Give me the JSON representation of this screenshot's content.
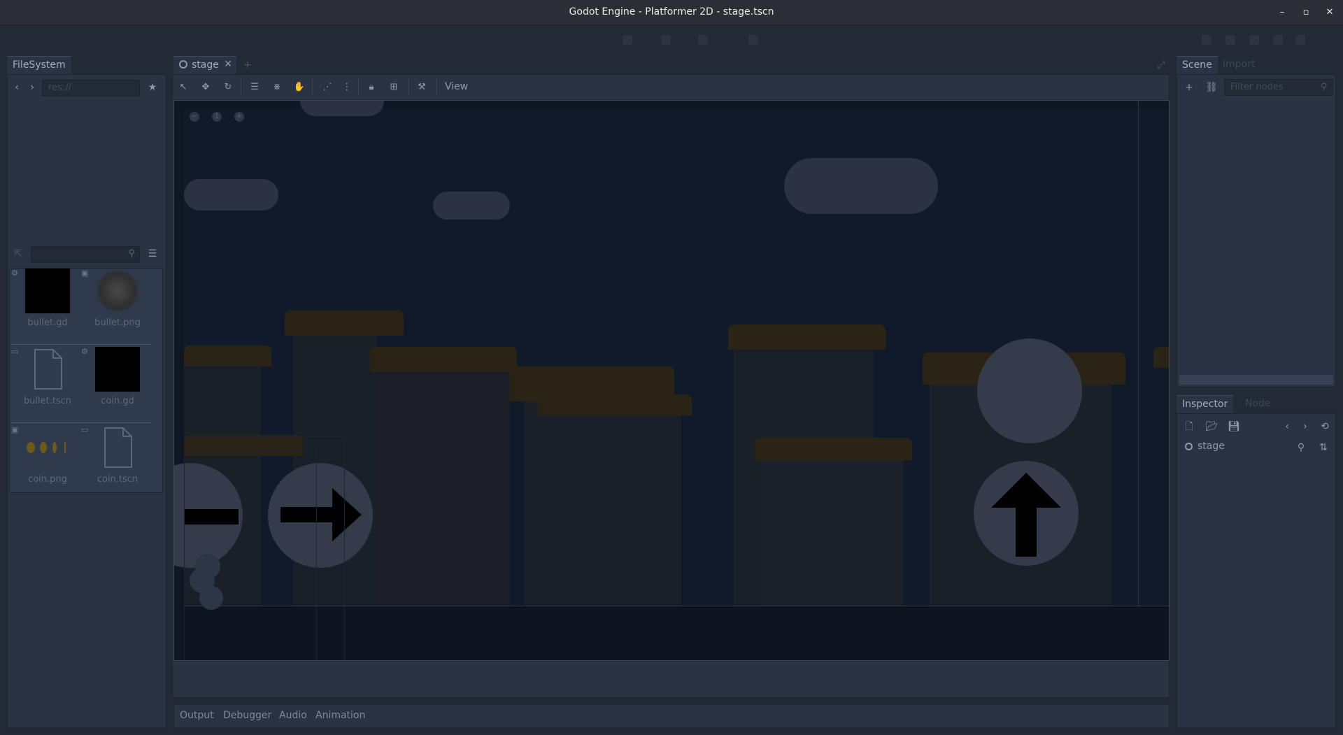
{
  "window": {
    "title": "Godot Engine - Platformer 2D - stage.tscn",
    "minimize": "–",
    "maximize": "▫",
    "close": "✕"
  },
  "filesystem": {
    "tab_label": "FileSystem",
    "path_value": "res://",
    "search_placeholder": "",
    "files": [
      {
        "name": "bullet.gd",
        "kind": "script"
      },
      {
        "name": "bullet.png",
        "kind": "image"
      },
      {
        "name": "bullet.tscn",
        "kind": "scene"
      },
      {
        "name": "coin.gd",
        "kind": "script"
      },
      {
        "name": "coin.png",
        "kind": "image"
      },
      {
        "name": "coin.tscn",
        "kind": "scene"
      }
    ]
  },
  "editor": {
    "scene_tab": "stage",
    "view_menu": "View"
  },
  "scene_dock": {
    "tabs": [
      "Scene",
      "Import"
    ],
    "filter_placeholder": "Filter nodes"
  },
  "inspector": {
    "tabs": [
      "Inspector",
      "Node"
    ],
    "node_name": "stage"
  },
  "bottom": {
    "tabs": [
      "Output",
      "Debugger",
      "Audio",
      "Animation"
    ]
  },
  "colors": {
    "accent": "#3b4a66",
    "pillar_top": "#2a2416",
    "sky": "#111a2b"
  }
}
